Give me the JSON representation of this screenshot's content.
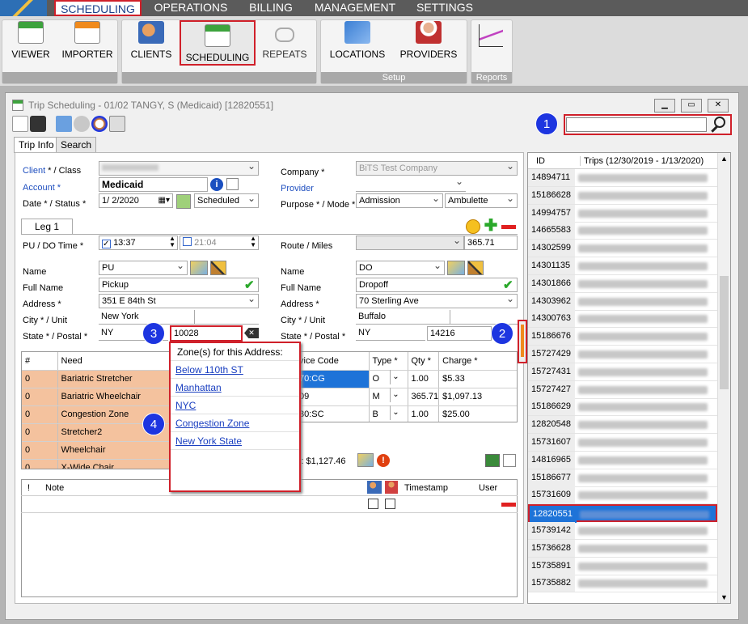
{
  "menu": {
    "items": [
      "SCHEDULING",
      "OPERATIONS",
      "BILLING",
      "MANAGEMENT",
      "SETTINGS"
    ]
  },
  "ribbon": {
    "buttons": [
      "VIEWER",
      "IMPORTER",
      "CLIENTS",
      "SCHEDULING",
      "REPEATS",
      "LOCATIONS",
      "PROVIDERS"
    ],
    "groups": {
      "setup": "Setup",
      "reports": "Reports"
    }
  },
  "window": {
    "title": "Trip Scheduling - 01/02 TANGY, S (Medicaid) [12820551]"
  },
  "tabs": [
    "Trip Info",
    "Search"
  ],
  "form": {
    "client_label": "Client",
    "class_label": " * / Class",
    "account_label": "Account *",
    "account_value": "Medicaid",
    "date_status_label": "Date * / Status *",
    "date_value": "1/ 2/2020",
    "status_value": "Scheduled",
    "company_label": "Company *",
    "company_value": "BiTS Test Company",
    "provider_label": "Provider",
    "purpose_mode_label": "Purpose * / Mode *",
    "purpose_value": "Admission",
    "mode_value": "Ambulette",
    "leg_tab": "Leg 1",
    "pu_do_time_label": "PU / DO Time *",
    "pu_time": "13:37",
    "do_time": "21:04",
    "route_miles_label": "Route / Miles",
    "miles_value": "365.71",
    "pickup": {
      "name_label": "Name",
      "name_value": "PU",
      "fullname_label": "Full Name",
      "fullname_value": "Pickup",
      "address_label": "Address *",
      "address_value": "351 E 84th St",
      "city_label": "City * / Unit",
      "city_value": "New York",
      "state_label": "State * / Postal *",
      "state_value": "NY",
      "postal_value": "10028"
    },
    "dropoff": {
      "name_label": "Name",
      "name_value": "DO",
      "fullname_label": "Full Name",
      "fullname_value": "Dropoff",
      "address_label": "Address *",
      "address_value": "70 Sterling Ave",
      "city_label": "City * / Unit",
      "city_value": "Buffalo",
      "state_label": "State * / Postal *",
      "state_value": "NY",
      "postal_value": "14216"
    }
  },
  "needs": {
    "headers": [
      "#",
      "Need"
    ],
    "rows": [
      {
        "num": "0",
        "need": "Bariatric Stretcher"
      },
      {
        "num": "0",
        "need": "Bariatric Wheelchair"
      },
      {
        "num": "0",
        "need": "Congestion Zone"
      },
      {
        "num": "0",
        "need": "Stretcher2"
      },
      {
        "num": "0",
        "need": "Wheelchair"
      },
      {
        "num": "0",
        "need": "X-Wide Chair"
      }
    ]
  },
  "services": {
    "headers": [
      "vice Code",
      "Type *",
      "Qty *",
      "Charge *"
    ],
    "rows": [
      {
        "code": "70:CG",
        "type": "O",
        "qty": "1.00",
        "charge": "$5.33"
      },
      {
        "code": "09",
        "type": "M",
        "qty": "365.71",
        "charge": "$1,097.13"
      },
      {
        "code": "30:SC",
        "type": "B",
        "qty": "1.00",
        "charge": "$25.00"
      }
    ],
    "total": "l: $1,127.46"
  },
  "notes": {
    "headers": [
      "!",
      "Note",
      "Timestamp",
      "User"
    ]
  },
  "zone_popup": {
    "title": "Zone(s) for this Address:",
    "zones": [
      "Below 110th ST",
      "Manhattan",
      "NYC",
      "Congestion Zone",
      "New York State"
    ]
  },
  "trips": {
    "id_header": "ID",
    "trips_header": "Trips (12/30/2019 - 1/13/2020)",
    "ids": [
      "14894711",
      "15186628",
      "14994757",
      "14665583",
      "14302599",
      "14301135",
      "14301866",
      "14303962",
      "14300763",
      "15186676",
      "15727429",
      "15727431",
      "15727427",
      "15186629",
      "12820548",
      "15731607",
      "14816965",
      "15186677",
      "15731609",
      "12820551",
      "15739142",
      "15736628",
      "15735891",
      "15735882"
    ],
    "selected": "12820551"
  },
  "badges": [
    "1",
    "2",
    "3",
    "4"
  ]
}
